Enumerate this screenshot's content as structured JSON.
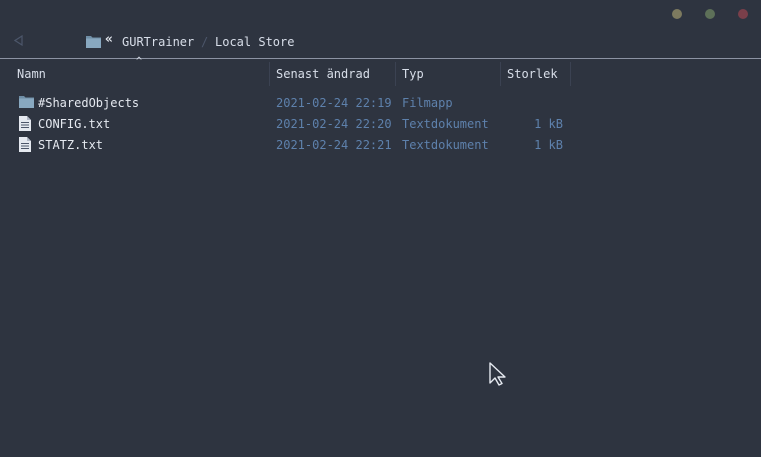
{
  "window": {
    "controls": [
      "minimize",
      "maximize",
      "close"
    ]
  },
  "addressbar": {
    "back_icon": "back-arrow-icon",
    "folder_icon": "folder-icon",
    "chevron": "«",
    "crumbs": [
      "GURTrainer",
      "Local Store"
    ],
    "separator": "/"
  },
  "columns": {
    "name": "Namn",
    "modified": "Senast ändrad",
    "type": "Typ",
    "size": "Storlek",
    "sort_indicator": "^"
  },
  "files": [
    {
      "name": "#SharedObjects",
      "modified": "2021-02-24 22:19",
      "type": "Filmapp",
      "size": "",
      "icon": "folder-icon"
    },
    {
      "name": "CONFIG.txt",
      "modified": "2021-02-24 22:20",
      "type": "Textdokument",
      "size": "1 kB",
      "icon": "text-file-icon"
    },
    {
      "name": "STATZ.txt",
      "modified": "2021-02-24 22:21",
      "type": "Textdokument",
      "size": "1 kB",
      "icon": "text-file-icon"
    }
  ],
  "colors": {
    "background": "#2e3440",
    "text": "#d8dee9",
    "meta_text": "#5e81ac",
    "folder": "#88a8c0"
  }
}
